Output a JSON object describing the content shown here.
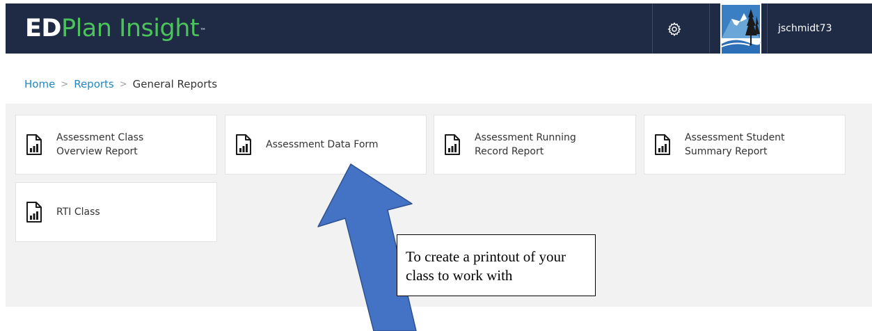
{
  "header": {
    "logo_ed": "ED",
    "logo_rest": "Plan Insight",
    "logo_tm": "™",
    "username": "jschmidt73"
  },
  "breadcrumb": {
    "home": "Home",
    "reports": "Reports",
    "current": "General Reports",
    "separator": ">"
  },
  "reports": [
    {
      "label": "Assessment Class Overview Report"
    },
    {
      "label": "Assessment Data Form"
    },
    {
      "label": "Assessment Running Record Report"
    },
    {
      "label": "Assessment Student Summary Report"
    },
    {
      "label": "RTI Class"
    }
  ],
  "annotation": {
    "text": "To create a printout of your class to work with",
    "arrow_color": "#4472c4"
  },
  "colors": {
    "header_bg": "#1f2a44",
    "logo_green": "#4cc25c",
    "link_blue": "#1e88c7",
    "panel_bg": "#f2f2f2"
  }
}
